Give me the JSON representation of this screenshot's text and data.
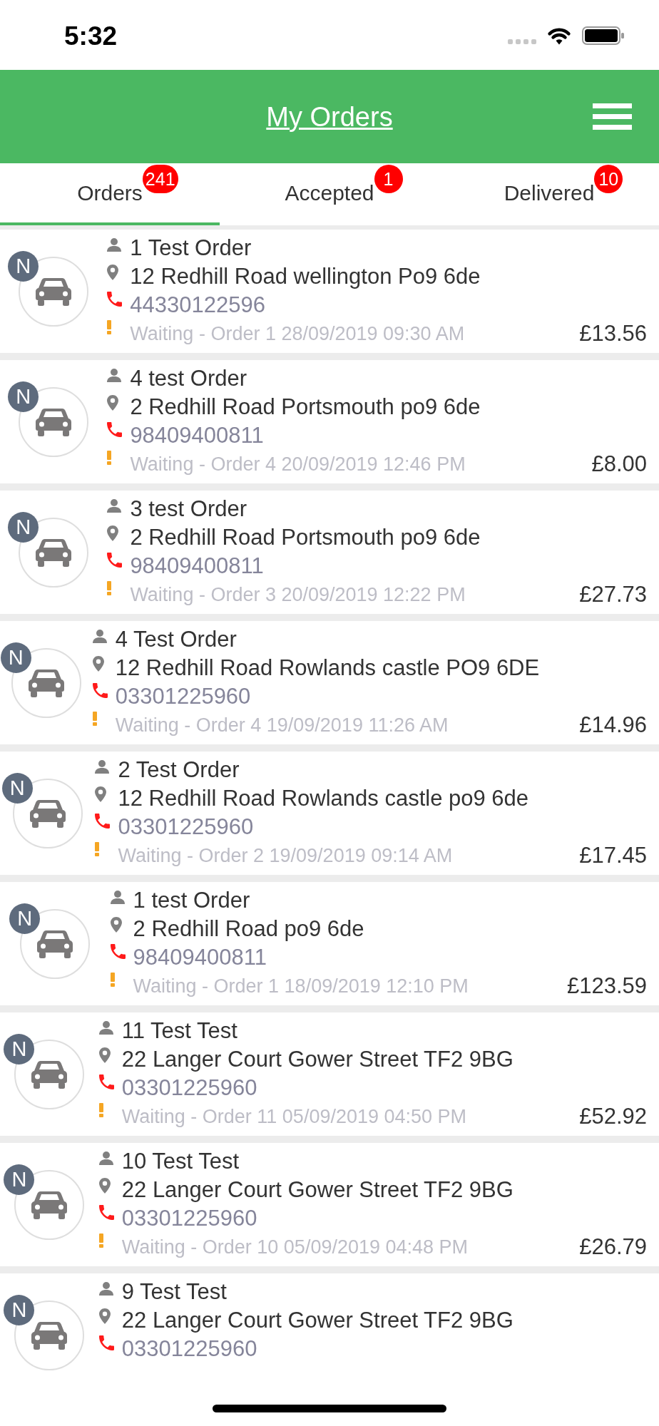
{
  "status_bar": {
    "time": "5:32"
  },
  "header": {
    "title": "My Orders"
  },
  "tabs": [
    {
      "label": "Orders",
      "badge": "241",
      "selected": true
    },
    {
      "label": "Accepted",
      "badge": "1",
      "selected": false
    },
    {
      "label": "Delivered",
      "badge": "10",
      "selected": false
    }
  ],
  "orders": [
    {
      "badge": "N",
      "customer": "1 Test Order",
      "address": "12 Redhill Road wellington Po9 6de",
      "phone": "44330122596",
      "status": "Waiting - Order 1 28/09/2019 09:30 AM",
      "total": "£13.56"
    },
    {
      "badge": "N",
      "customer": "4 test Order",
      "address": "2 Redhill Road Portsmouth po9 6de",
      "phone": "98409400811",
      "status": "Waiting - Order 4 20/09/2019 12:46 PM",
      "total": "£8.00"
    },
    {
      "badge": "N",
      "customer": "3 test Order",
      "address": "2 Redhill Road Portsmouth po9 6de",
      "phone": "98409400811",
      "status": "Waiting - Order 3 20/09/2019 12:22 PM",
      "total": "£27.73"
    },
    {
      "badge": "N",
      "customer": "4 Test Order",
      "address": "12 Redhill Road Rowlands castle PO9 6DE",
      "phone": "03301225960",
      "status": "Waiting - Order 4 19/09/2019 11:26 AM",
      "total": "£14.96"
    },
    {
      "badge": "N",
      "customer": "2 Test Order",
      "address": "12 Redhill Road Rowlands castle po9 6de",
      "phone": "03301225960",
      "status": "Waiting - Order 2 19/09/2019 09:14 AM",
      "total": "£17.45"
    },
    {
      "badge": "N",
      "customer": "1 test Order",
      "address": "2 Redhill Road po9 6de",
      "phone": "98409400811",
      "status": "Waiting - Order 1 18/09/2019 12:10 PM",
      "total": "£123.59"
    },
    {
      "badge": "N",
      "customer": "11 Test Test",
      "address": "22 Langer Court Gower Street TF2 9BG",
      "phone": "03301225960",
      "status": "Waiting - Order 11 05/09/2019 04:50 PM",
      "total": "£52.92"
    },
    {
      "badge": "N",
      "customer": "10 Test Test",
      "address": "22 Langer Court Gower Street TF2 9BG",
      "phone": "03301225960",
      "status": "Waiting - Order 10 05/09/2019 04:48 PM",
      "total": "£26.79"
    },
    {
      "badge": "N",
      "customer": "9 Test Test",
      "address": "22 Langer Court Gower Street TF2 9BG",
      "phone": "03301225960"
    }
  ]
}
